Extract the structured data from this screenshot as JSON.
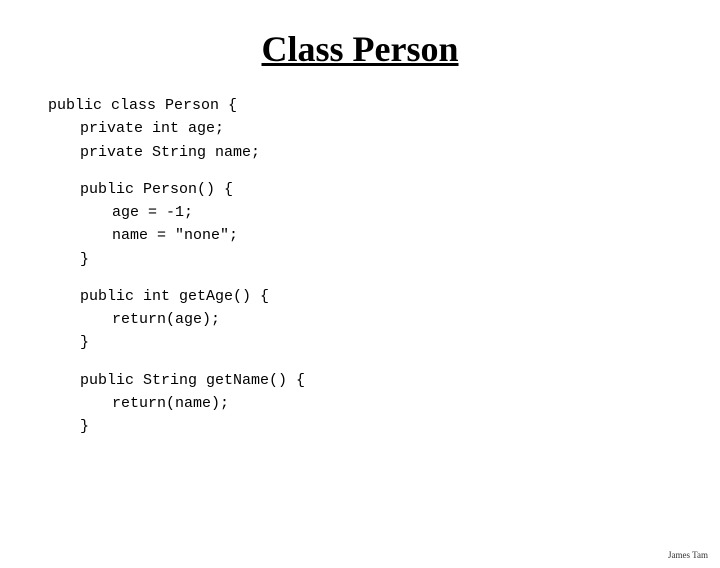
{
  "title": "Class Person",
  "watermark": "James Tam",
  "code": {
    "line1": "public class Person {",
    "line2": "private int age;",
    "line3": "private String name;",
    "blank1": "",
    "line4": "public Person() {",
    "line5": "age = -1;",
    "line6": "name = \"none\";",
    "line7": "}",
    "blank2": "",
    "line8": "public int getAge() {",
    "line9": "return(age);",
    "line10": "}",
    "blank3": "",
    "line11": "public String getName() {",
    "line12": "return(name);",
    "line13": "}"
  }
}
